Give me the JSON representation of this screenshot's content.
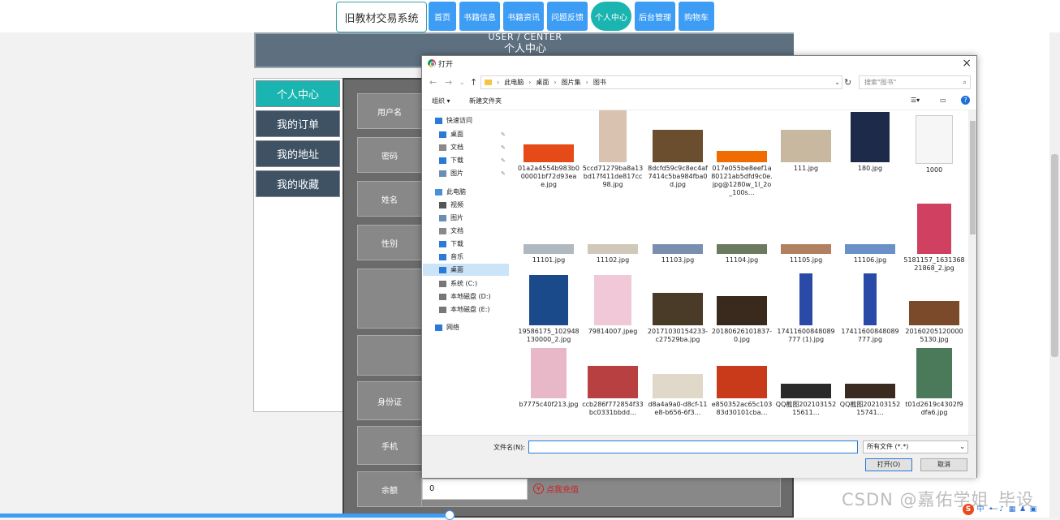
{
  "site": {
    "brand": "旧教材交易系统",
    "nav": [
      "首页",
      "书籍信息",
      "书籍资讯",
      "问题反馈",
      "个人中心",
      "后台管理",
      "购物车"
    ],
    "active_nav": "个人中心",
    "accent_color": "#1ab5b1",
    "nav_color": "#3d9df5"
  },
  "banner": {
    "en": "USER / CENTER",
    "cn": "个人中心"
  },
  "sidebar": {
    "items": [
      "个人中心",
      "我的订单",
      "我的地址",
      "我的收藏"
    ]
  },
  "form": {
    "labels": [
      "用户名",
      "密码",
      "姓名",
      "性别",
      "",
      "",
      "身份证",
      "手机",
      "余额"
    ],
    "balance_value": "0",
    "recharge_label": "点我充值",
    "coin_icon": "¥"
  },
  "watermark": "CSDN @嘉佑学姐_毕设",
  "dialog": {
    "title": "打开",
    "close": "×",
    "path": [
      "此电脑",
      "桌面",
      "图片集",
      "图书"
    ],
    "search_placeholder": "搜索\"图书\"",
    "toolbar": {
      "organize": "组织 ▾",
      "new_folder": "新建文件夹"
    },
    "nav_items": [
      {
        "label": "快速访问",
        "icon": "star-icon"
      },
      {
        "label": "桌面",
        "icon": "desktop-icon",
        "pin": true
      },
      {
        "label": "文档",
        "icon": "document-icon",
        "pin": true
      },
      {
        "label": "下载",
        "icon": "download-icon",
        "pin": true
      },
      {
        "label": "图片",
        "icon": "picture-icon",
        "pin": true
      },
      {
        "label": "此电脑",
        "icon": "computer-icon"
      },
      {
        "label": "视频",
        "icon": "video-icon"
      },
      {
        "label": "图片",
        "icon": "picture-icon"
      },
      {
        "label": "文档",
        "icon": "document-icon"
      },
      {
        "label": "下载",
        "icon": "download-icon"
      },
      {
        "label": "音乐",
        "icon": "music-icon"
      },
      {
        "label": "桌面",
        "icon": "desktop-icon",
        "selected": true
      },
      {
        "label": "系统 (C:)",
        "icon": "drive-icon"
      },
      {
        "label": "本地磁盘 (D:)",
        "icon": "drive-icon"
      },
      {
        "label": "本地磁盘 (E:)",
        "icon": "drive-icon"
      },
      {
        "label": "网络",
        "icon": "network-icon"
      }
    ],
    "files": [
      "01a2a4554b983b000001bf72d93eae.jpg",
      "5ccd71279ba8a13bd17f411de817cc98.jpg",
      "8dcfd59c9c8ec4af7414c5ba984fba0d.jpg",
      "017e055be8eef1a80121ab5dfd9c0e.jpg@1280w_1l_2o_100s…",
      "111.jpg",
      "180.jpg",
      "1000",
      "11101.jpg",
      "11102.jpg",
      "11103.jpg",
      "11104.jpg",
      "11105.jpg",
      "11106.jpg",
      "5181157_163136821868_2.jpg",
      "19586175_102948130000_2.jpg",
      "79814007.jpeg",
      "20171030154233-c27529ba.jpg",
      "20180626101837-0.jpg",
      "17411600848089777 (1).jpg",
      "17411600848089777.jpg",
      "201602051200005130.jpg",
      "b7775c40f213.jpg",
      "ccb286f772854f33bc0331bbdd…",
      "d8a4a9a0-d8cf-11e8-b656-6f3…",
      "e850352ac65c10383d30101cba…",
      "QQ截图20210315215611…",
      "QQ截图20210315215741…",
      "t01d2619c4302f9dfa6.jpg"
    ],
    "filename_label": "文件名(N):",
    "filename_value": "",
    "filetype": "所有文件 (*.*)",
    "open_button": "打开(O)",
    "cancel_button": "取消"
  }
}
